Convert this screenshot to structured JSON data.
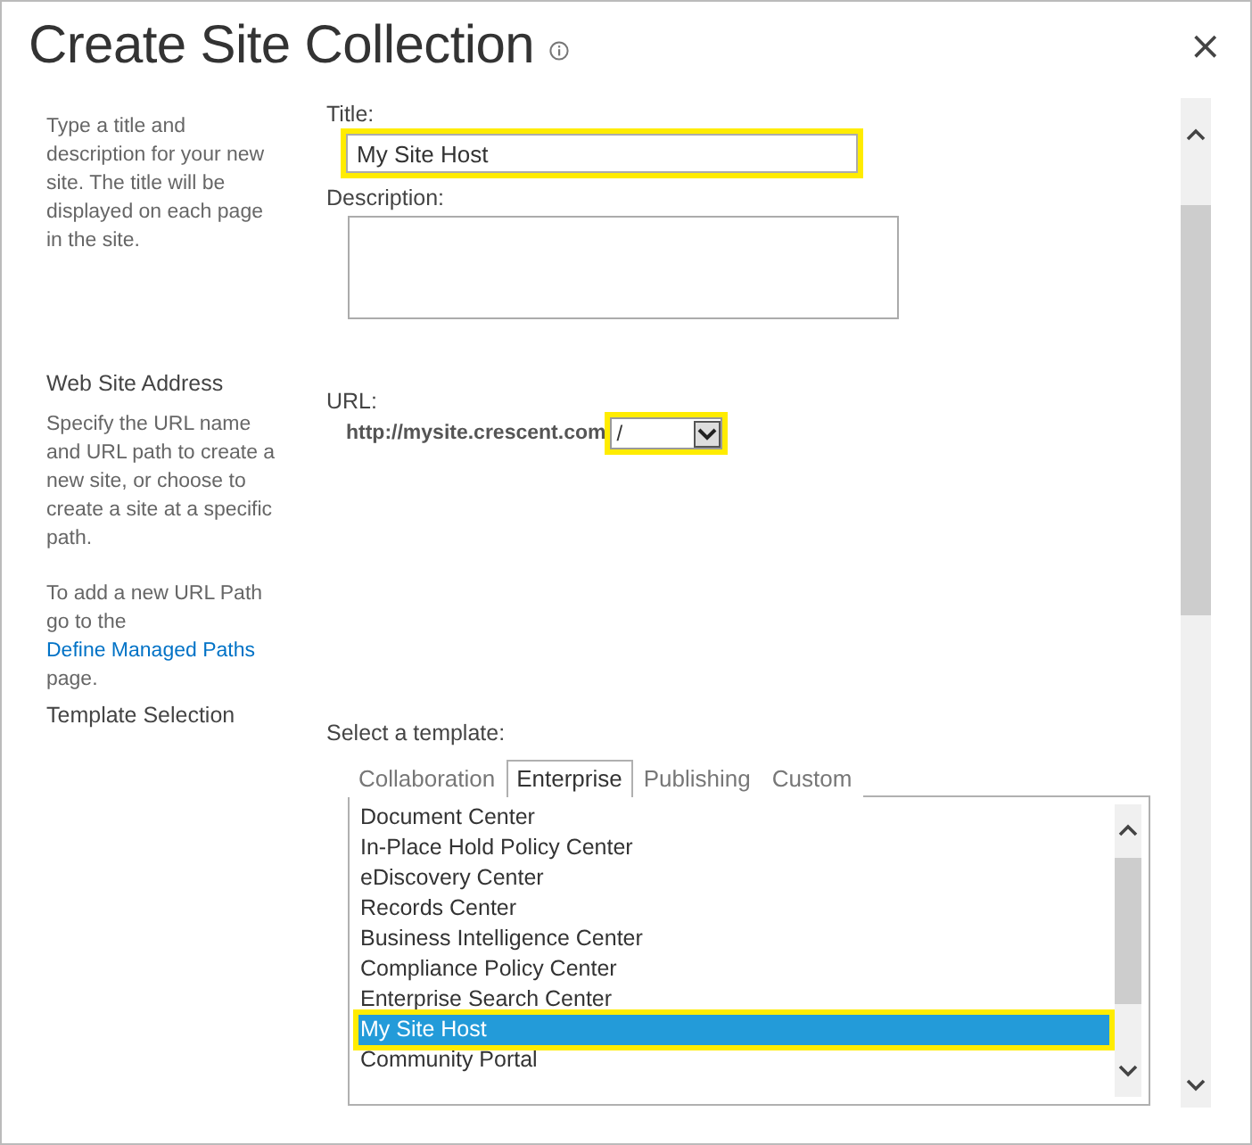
{
  "dialog": {
    "title": "Create Site Collection",
    "close_label": "×"
  },
  "sections": [
    {
      "description": "Type a title and description for your new site. The title will be displayed on each page in the site.",
      "kind": "title"
    },
    {
      "heading": "Web Site Address",
      "description": "Specify the URL name and URL path to create a new site, or choose to create a site at a specific path.",
      "note": {
        "before": "To add a new URL Path go to the",
        "link": "Define Managed Paths",
        "after": "page."
      },
      "kind": "url"
    },
    {
      "heading": "Template Selection",
      "kind": "template"
    }
  ],
  "title_field": {
    "label": "Title:",
    "value": "My Site Host",
    "highlighted": true
  },
  "description_field": {
    "label": "Description:"
  },
  "url": {
    "label": "URL:",
    "prefix": "http://mysite.crescent.com",
    "path": "/",
    "highlighted": true
  },
  "template": {
    "label": "Select a template:",
    "tabs": [
      {
        "label": "Collaboration",
        "selected": false
      },
      {
        "label": "Enterprise",
        "selected": true
      },
      {
        "label": "Publishing",
        "selected": false
      },
      {
        "label": "Custom",
        "selected": false
      }
    ],
    "items": [
      {
        "label": "Document Center",
        "selected": false
      },
      {
        "label": "In-Place Hold Policy Center",
        "selected": false
      },
      {
        "label": "eDiscovery Center",
        "selected": false
      },
      {
        "label": "Records Center",
        "selected": false
      },
      {
        "label": "Business Intelligence Center",
        "selected": false
      },
      {
        "label": "Compliance Policy Center",
        "selected": false
      },
      {
        "label": "Enterprise Search Center",
        "selected": false
      },
      {
        "label": "My Site Host",
        "selected": true,
        "highlighted": true
      },
      {
        "label": "Community Portal",
        "selected": false
      }
    ]
  }
}
